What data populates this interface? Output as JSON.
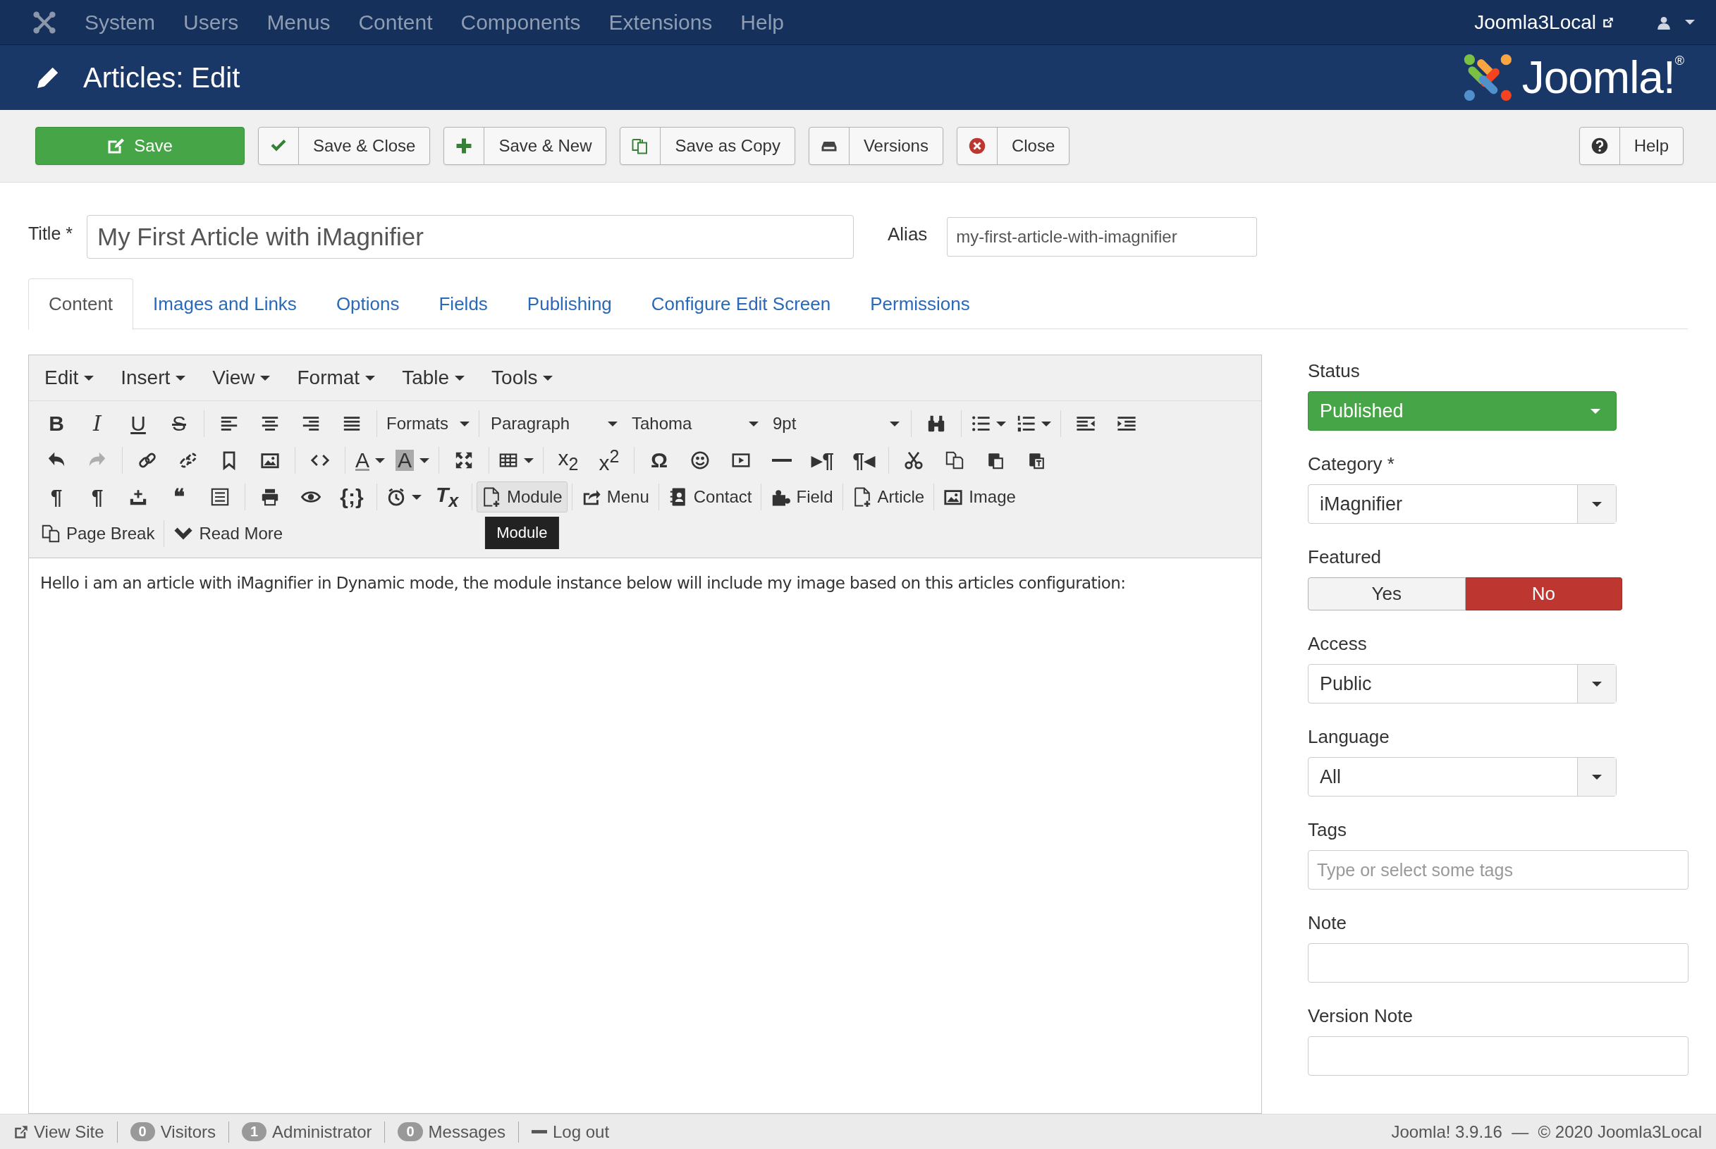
{
  "topnav": {
    "menus": [
      "System",
      "Users",
      "Menus",
      "Content",
      "Components",
      "Extensions",
      "Help"
    ],
    "site": "Joomla3Local"
  },
  "header": {
    "title": "Articles: Edit",
    "logo": "Joomla!$^{®}$"
  },
  "actions": [
    {
      "label": "Save",
      "kind": "save"
    },
    {
      "label": "Save & Close",
      "kind": "apply"
    },
    {
      "label": "Save & New",
      "kind": "new"
    },
    {
      "label": "Save as Copy",
      "kind": "copy"
    },
    {
      "label": "Versions",
      "kind": "versions"
    },
    {
      "label": "Close",
      "kind": "cancel"
    },
    {
      "label": "Help",
      "kind": "help"
    }
  ],
  "title_field": {
    "label": "Title *",
    "value": "My First Article with iMagnifier"
  },
  "alias_field": {
    "label": "Alias",
    "value": "my-first-article-with-imagnifier"
  },
  "tabs": [
    {
      "label": "Content",
      "selected": true
    },
    {
      "label": "Images and Links",
      "selected": false
    },
    {
      "label": "Options",
      "selected": false
    },
    {
      "label": "Fields",
      "selected": false
    },
    {
      "label": "Publishing",
      "selected": false
    },
    {
      "label": "Configure Edit Screen",
      "selected": false
    },
    {
      "label": "Permissions",
      "selected": false
    }
  ],
  "editor": {
    "menus": [
      "Edit",
      "Insert",
      "View",
      "Format",
      "Table",
      "Tools"
    ],
    "toolbars": [
      {
        "buttons": [
          {
            "kind": "bold",
            "glyph": "B"
          },
          {
            "kind": "italic",
            "glyph": "I"
          },
          {
            "kind": "underline",
            "glyph": "U"
          },
          {
            "kind": "strike",
            "glyph": "S"
          },
          {
            "kind": "sep"
          },
          {
            "kind": "alignleft"
          },
          {
            "kind": "aligncenter"
          },
          {
            "kind": "alignright"
          },
          {
            "kind": "justify"
          },
          {
            "kind": "sep"
          },
          {
            "kind": "menu",
            "label": "Formats"
          },
          {
            "kind": "sep"
          },
          {
            "kind": "select",
            "label": "Paragraph"
          },
          {
            "kind": "select",
            "label": "Tahoma"
          },
          {
            "kind": "select",
            "label": "9pt"
          },
          {
            "kind": "sep"
          },
          {
            "kind": "find"
          },
          {
            "kind": "sep"
          },
          {
            "kind": "bullist",
            "caret": true
          },
          {
            "kind": "numlist",
            "caret": true
          },
          {
            "kind": "sep"
          },
          {
            "kind": "outdent"
          },
          {
            "kind": "indent"
          }
        ]
      },
      {
        "buttons": [
          {
            "kind": "undo"
          },
          {
            "kind": "redo",
            "disabled": true
          },
          {
            "kind": "sep"
          },
          {
            "kind": "link"
          },
          {
            "kind": "unlink"
          },
          {
            "kind": "bookmark"
          },
          {
            "kind": "image"
          },
          {
            "kind": "sep"
          },
          {
            "kind": "code"
          },
          {
            "kind": "sep"
          },
          {
            "kind": "forecolor",
            "glyph": "A",
            "caret": true
          },
          {
            "kind": "backcolor",
            "glyph": "A",
            "caret": true
          },
          {
            "kind": "sep"
          },
          {
            "kind": "fullscreen"
          },
          {
            "kind": "sep"
          },
          {
            "kind": "table",
            "caret": true
          },
          {
            "kind": "sep"
          },
          {
            "kind": "plain",
            "glyph": "x$_{2}$"
          },
          {
            "kind": "plain",
            "glyph": "x$^{2}$"
          },
          {
            "kind": "sep"
          },
          {
            "kind": "symbol",
            "glyph": "Ω"
          },
          {
            "kind": "emoticon"
          },
          {
            "kind": "media"
          },
          {
            "kind": "hr"
          },
          {
            "kind": "symbol",
            "glyph": "▸¶"
          },
          {
            "kind": "symbol",
            "glyph": "¶◂"
          },
          {
            "kind": "sep"
          },
          {
            "kind": "cut"
          },
          {
            "kind": "copy"
          },
          {
            "kind": "paste"
          },
          {
            "kind": "pastetext"
          }
        ]
      },
      {
        "buttons": [
          {
            "kind": "symbol",
            "glyph": "¶"
          },
          {
            "kind": "symbol",
            "glyph": "¶"
          },
          {
            "kind": "insert"
          },
          {
            "kind": "symbol",
            "glyph": "❝"
          },
          {
            "kind": "template"
          },
          {
            "kind": "sep"
          },
          {
            "kind": "print"
          },
          {
            "kind": "preview"
          },
          {
            "kind": "symbol",
            "glyph": "{;}"
          },
          {
            "kind": "sep"
          },
          {
            "kind": "clock",
            "caret": true
          },
          {
            "kind": "clearformat",
            "glyph": "T$_{x}$"
          },
          {
            "kind": "sep"
          },
          {
            "kind": "module",
            "label": "Module",
            "selected": true,
            "tooltip": "Module"
          },
          {
            "kind": "sep"
          },
          {
            "kind": "share",
            "label": "Menu",
            "selected": false
          },
          {
            "kind": "sep"
          },
          {
            "kind": "contact",
            "label": "Contact",
            "selected": false
          },
          {
            "kind": "sep"
          },
          {
            "kind": "puzzle",
            "label": "Field",
            "selected": false
          },
          {
            "kind": "sep"
          },
          {
            "kind": "article",
            "label": "Article",
            "selected": false
          },
          {
            "kind": "sep"
          },
          {
            "kind": "picture",
            "label": "Image",
            "selected": false
          }
        ]
      },
      {
        "buttons": [
          {
            "kind": "pagebreak",
            "label": "Page Break",
            "selected": false
          },
          {
            "kind": "sep"
          },
          {
            "kind": "readmore",
            "label": "Read More",
            "selected": false
          }
        ]
      }
    ],
    "text": "Hello i am an article with iMagnifier in Dynamic mode, the module instance below will include my image based on this articles configuration:"
  },
  "sidebar": [
    {
      "label": "Status",
      "kind": "status",
      "value": "Published"
    },
    {
      "label": "Category *",
      "kind": "select",
      "value": "iMagnifier"
    },
    {
      "label": "Featured",
      "kind": "toggle",
      "options": [
        {
          "label": "Yes",
          "selected": false
        },
        {
          "label": "No",
          "selected": true
        }
      ]
    },
    {
      "label": "Access",
      "kind": "select",
      "value": "Public"
    },
    {
      "label": "Language",
      "kind": "select",
      "value": "All"
    },
    {
      "label": "Tags",
      "kind": "field",
      "placeholder": "Type or select some tags"
    },
    {
      "label": "Note",
      "kind": "field"
    },
    {
      "label": "Version Note",
      "kind": "field"
    }
  ],
  "status_bar": {
    "items": [
      {
        "kind": "link",
        "label": "View Site"
      },
      {
        "kind": "count",
        "count": "0",
        "label": "Visitors"
      },
      {
        "kind": "count",
        "count": "1",
        "label": "Administrator"
      },
      {
        "kind": "count",
        "count": "0",
        "label": "Messages"
      },
      {
        "kind": "logout",
        "label": "Log out"
      }
    ],
    "version": "Joomla! 3.9.16  —  © 2020 Joomla3Local"
  }
}
